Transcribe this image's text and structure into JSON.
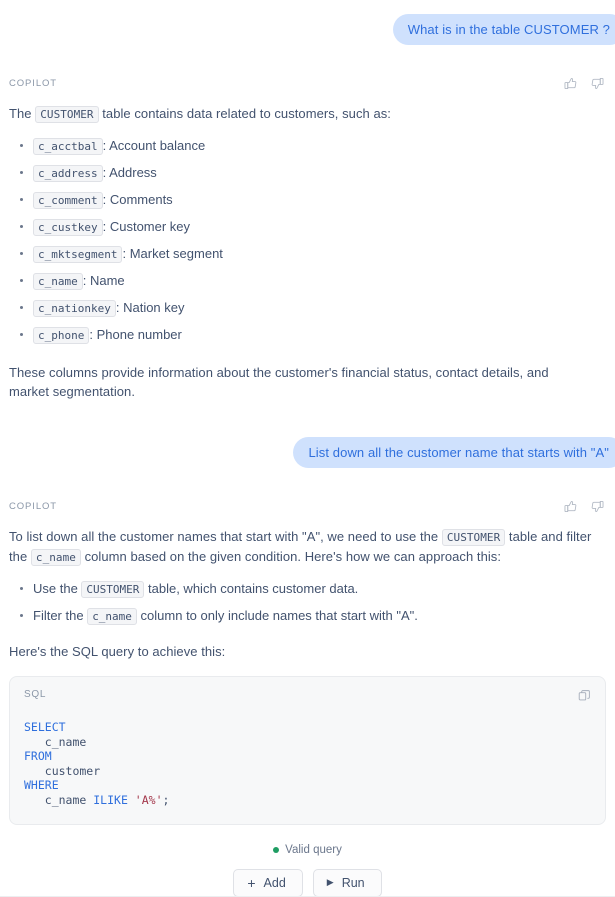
{
  "conversation": [
    {
      "role": "user",
      "text": "What is in the table CUSTOMER ?"
    },
    {
      "role": "copilot",
      "label": "COPILOT",
      "intro_before": "The ",
      "intro_code": "CUSTOMER",
      "intro_after": " table contains data related to customers, such as:",
      "columns": [
        {
          "code": "c_acctbal",
          "desc": ": Account balance"
        },
        {
          "code": "c_address",
          "desc": ": Address"
        },
        {
          "code": "c_comment",
          "desc": ": Comments"
        },
        {
          "code": "c_custkey",
          "desc": ": Customer key"
        },
        {
          "code": "c_mktsegment",
          "desc": ": Market segment"
        },
        {
          "code": "c_name",
          "desc": ": Name"
        },
        {
          "code": "c_nationkey",
          "desc": ": Nation key"
        },
        {
          "code": "c_phone",
          "desc": ": Phone number"
        }
      ],
      "summary": "These columns provide information about the customer's financial status, contact details, and market segmentation."
    },
    {
      "role": "user",
      "text": "List down all the customer name that starts with \"A\""
    },
    {
      "role": "copilot",
      "label": "COPILOT",
      "intro_p1": "To list down all the customer names that start with \"A\", we need to use the ",
      "intro_code1": "CUSTOMER",
      "intro_p2": " table and filter the ",
      "intro_code2": "c_name",
      "intro_p3": " column based on the given condition. Here's how we can approach this:",
      "steps": [
        {
          "pre": "Use the ",
          "code": "CUSTOMER",
          "post": " table, which contains customer data."
        },
        {
          "pre": "Filter the ",
          "code": "c_name",
          "post": " column to only include names that start with \"A\"."
        }
      ],
      "sql_intro": "Here's the SQL query to achieve this:"
    }
  ],
  "feedback": {
    "thumbs_up_icon": "thumbs-up-icon",
    "thumbs_down_icon": "thumbs-down-icon"
  },
  "sql_card": {
    "language": "SQL",
    "copy_icon": "copy-icon",
    "lines": [
      {
        "kw": "SELECT",
        "rest": ""
      },
      {
        "kw": "",
        "rest": "   c_name"
      },
      {
        "kw": "FROM",
        "rest": ""
      },
      {
        "kw": "",
        "rest": "   customer"
      },
      {
        "kw": "WHERE",
        "rest": ""
      },
      {
        "kw": "",
        "rest": "   c_name "
      }
    ],
    "code_select": "SELECT",
    "code_col": "   c_name",
    "code_from": "FROM",
    "code_table": "   customer",
    "code_where": "WHERE",
    "code_cond_col": "   c_name ",
    "code_cond_kw": "ILIKE",
    "code_cond_str": " 'A%'",
    "code_cond_end": ";"
  },
  "status": {
    "text": "Valid query",
    "dot_color": "#1f9d63"
  },
  "actions": {
    "add_label": "Add",
    "add_icon": "plus-icon",
    "run_label": "Run",
    "run_icon": "play-icon"
  },
  "colors": {
    "user_bubble_bg": "#cfe1fd",
    "user_bubble_text": "#2f6fdd",
    "body_text": "#42526e",
    "muted_text": "#8b97a8",
    "code_bg": "#f7f8f9",
    "keyword": "#2f6fdd",
    "string": "#a3364a",
    "valid_green": "#1f9d63"
  }
}
